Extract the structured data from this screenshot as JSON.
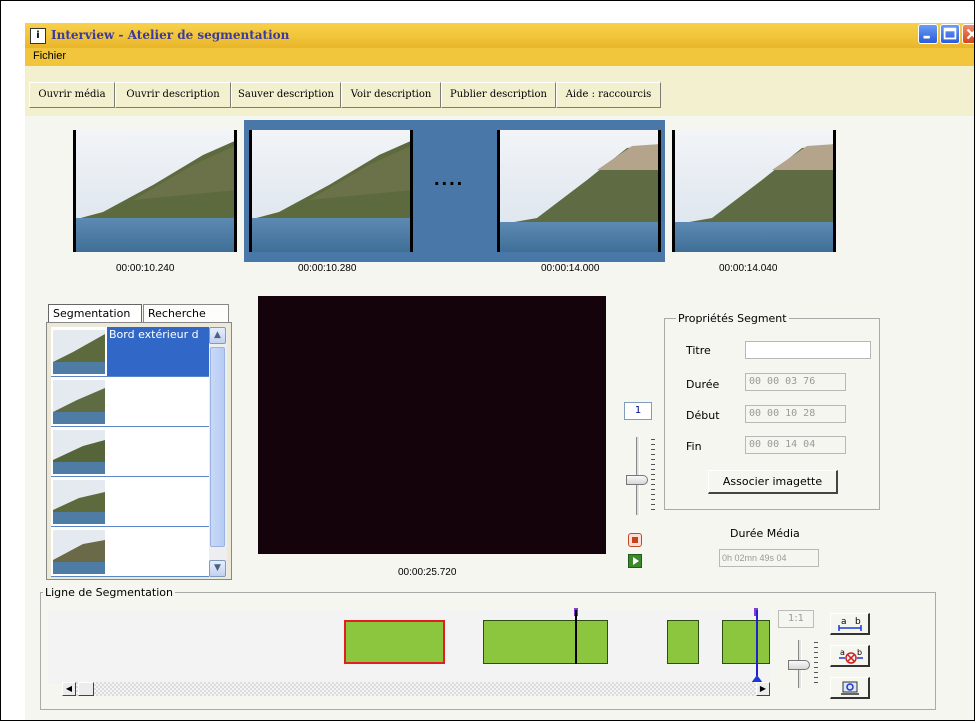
{
  "window": {
    "title": "Interview - Atelier de segmentation"
  },
  "menu": {
    "items": [
      "Fichier"
    ]
  },
  "toolbar": {
    "buttons": [
      "Ouvrir média",
      "Ouvrir description",
      "Sauver description",
      "Voir description",
      "Publier description",
      "Aide : raccourcis"
    ]
  },
  "thumbnails": {
    "timestamps": [
      "00:00:10.240",
      "00:00:10.280",
      "00:00:14.000",
      "00:00:14.040"
    ],
    "ellipsis": "...."
  },
  "segmentation_panel": {
    "tabs": [
      "Segmentation",
      "Recherche"
    ],
    "active_tab": "Segmentation",
    "items": [
      {
        "label": "Bord extérieur d"
      },
      {
        "label": ""
      },
      {
        "label": ""
      },
      {
        "label": ""
      },
      {
        "label": ""
      }
    ]
  },
  "player": {
    "time": "00:00:25.720",
    "speed": "1"
  },
  "segment_properties": {
    "legend": "Propriétés Segment",
    "titre_label": "Titre",
    "titre_value": "",
    "duree_label": "Durée",
    "duree_value": "00 00 03 76",
    "debut_label": "Début",
    "debut_value": "00 00 10 28",
    "fin_label": "Fin",
    "fin_value": "00 00 14 04",
    "associate_button": "Associer imagette"
  },
  "media": {
    "duree_label": "Durée Média",
    "duree_value": "0h 02mn 49s 04"
  },
  "segmentation_line": {
    "legend": "Ligne de Segmentation",
    "zoom": "1:1"
  },
  "colors": {
    "titlebar": "#f1c43a",
    "selection": "#4978a8",
    "segment_fill": "#8cc63e",
    "selected_segment_border": "#e02020",
    "cursor": "#2222cc"
  }
}
